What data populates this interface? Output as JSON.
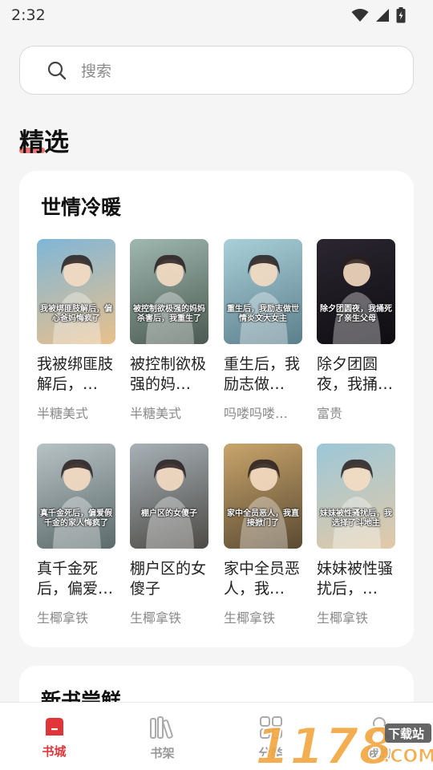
{
  "status_bar": {
    "time": "2:32"
  },
  "search": {
    "placeholder": "搜索"
  },
  "section": {
    "title": "精选"
  },
  "card": {
    "title": "世情冷暖",
    "books": [
      {
        "title": "我被绑匪肢解后，…",
        "author": "半糖美式",
        "cover_text": "我被绑匪肢解后，偏心爸妈悔疯了",
        "colors": [
          "#7fb6d8",
          "#e9c08b"
        ]
      },
      {
        "title": "被控制欲极强的妈…",
        "author": "半糖美式",
        "cover_text": "被控制欲极强的妈妈杀害后，我重生了",
        "colors": [
          "#9fb8b0",
          "#4b5a52"
        ]
      },
      {
        "title": "重生后，我励志做…",
        "author": "吗喽吗喽…",
        "cover_text": "重生后，我励志做世情炎文大女主",
        "colors": [
          "#a9d0d9",
          "#5c7f8c"
        ]
      },
      {
        "title": "除夕团圆夜，我捅…",
        "author": "富贵",
        "cover_text": "除夕团圆夜，我捅死了亲生父母",
        "colors": [
          "#2b2630",
          "#0f0d12"
        ]
      },
      {
        "title": "真千金死后，偏爱…",
        "author": "生椰拿铁",
        "cover_text": "真千金死后，偏爱假千金的家人悔疯了",
        "colors": [
          "#b7c2c4",
          "#5c6a6c"
        ]
      },
      {
        "title": "棚户区的女傻子",
        "author": "生椰拿铁",
        "cover_text": "棚户区的女傻子",
        "colors": [
          "#a8b1b7",
          "#4c4a45"
        ]
      },
      {
        "title": "家中全员恶人，我…",
        "author": "生椰拿铁",
        "cover_text": "家中全员恶人，我直接掀门了",
        "colors": [
          "#c9a56b",
          "#5a4a33"
        ]
      },
      {
        "title": "妹妹被性骚扰后，…",
        "author": "生椰拿铁",
        "cover_text": "妹妹被性骚扰后，我选择了斗地主",
        "colors": [
          "#9cc7d8",
          "#e2c9a8"
        ]
      }
    ]
  },
  "next_section": {
    "title": "新书尝鲜"
  },
  "nav": [
    {
      "label": "书城",
      "icon": "home-store-icon",
      "active": true
    },
    {
      "label": "书架",
      "icon": "bookshelf-icon",
      "active": false
    },
    {
      "label": "分类",
      "icon": "category-icon",
      "active": false
    },
    {
      "label": "我的",
      "icon": "profile-icon",
      "active": false
    }
  ],
  "watermark": {
    "text": "1178",
    "sub": "下载站",
    "domain": ".COM"
  },
  "colors": {
    "accent": "#e0363a",
    "background": "#f5f5f5",
    "card": "#ffffff"
  }
}
